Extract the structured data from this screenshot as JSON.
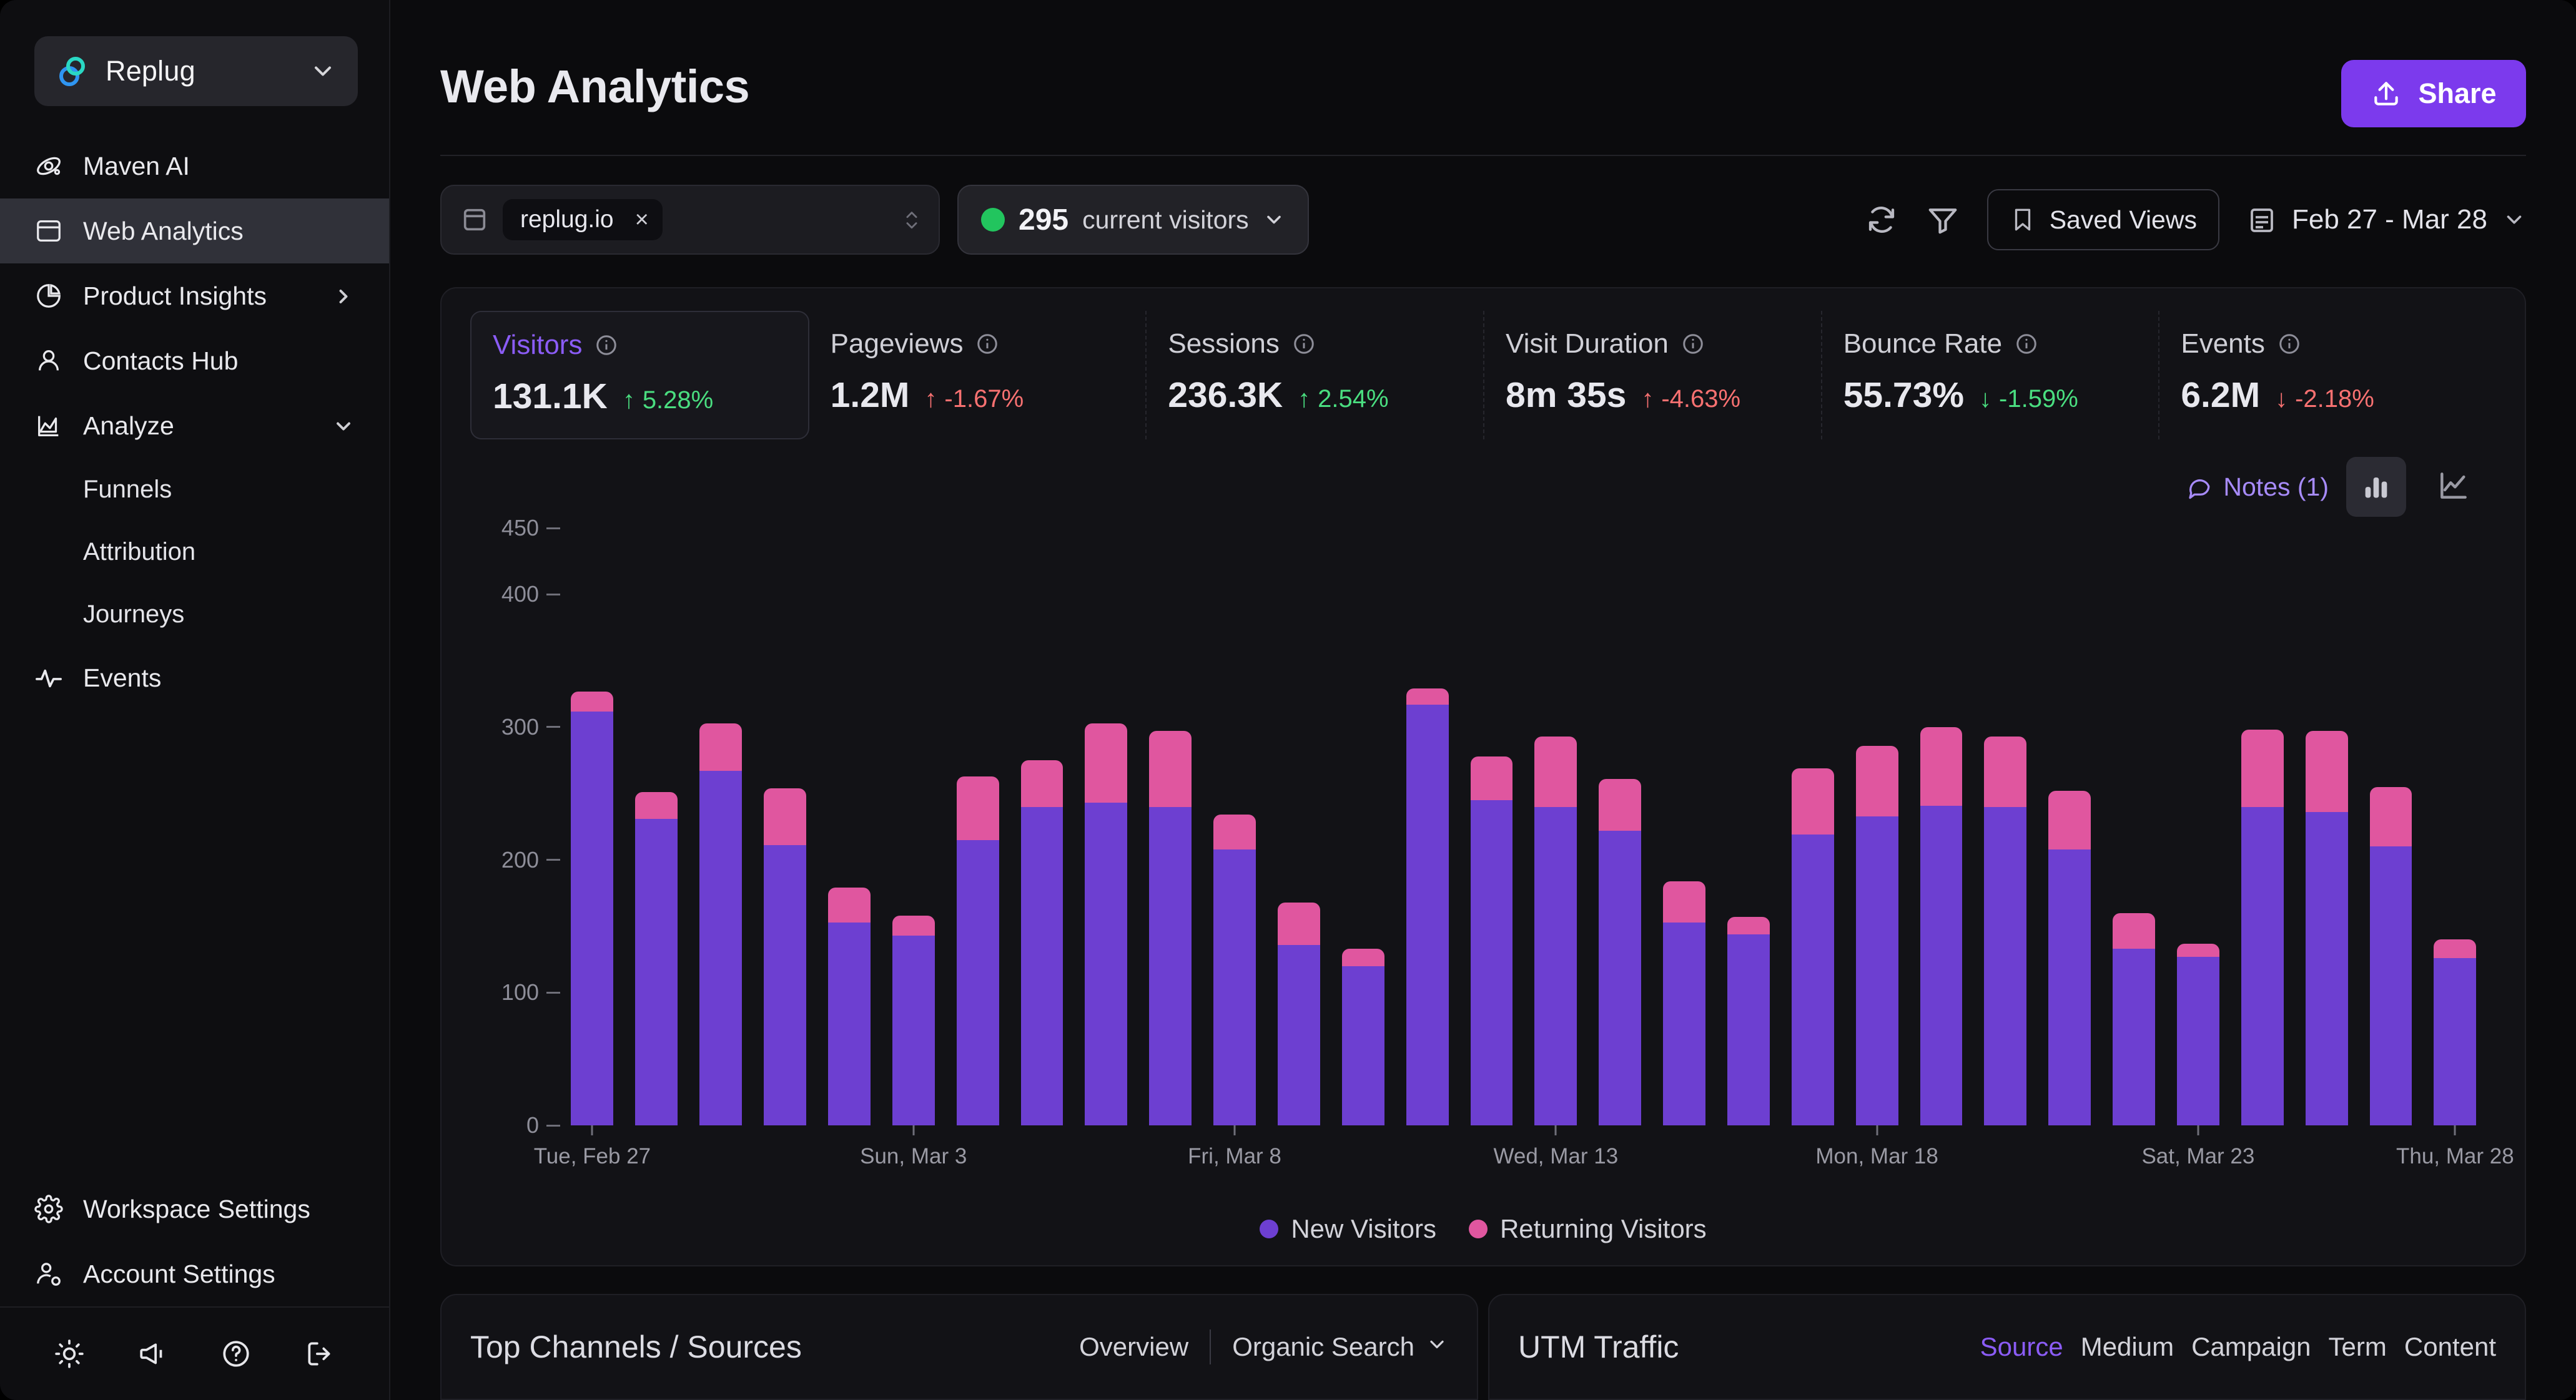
{
  "sidebar": {
    "workspace": {
      "name": "Replug",
      "icon": "replug-logo-icon",
      "chevron": "chevron-down-icon"
    },
    "items": [
      {
        "label": "Maven AI",
        "icon": "maven-ai-icon",
        "active": false,
        "caret": ""
      },
      {
        "label": "Web Analytics",
        "icon": "window-icon",
        "active": true,
        "caret": ""
      },
      {
        "label": "Product Insights",
        "icon": "pie-chart-icon",
        "active": false,
        "caret": "chevron-right-icon"
      },
      {
        "label": "Contacts Hub",
        "icon": "user-icon",
        "active": false,
        "caret": ""
      },
      {
        "label": "Analyze",
        "icon": "area-chart-icon",
        "active": false,
        "caret": "chevron-down-icon"
      }
    ],
    "sub_items": [
      "Funnels",
      "Attribution",
      "Journeys"
    ],
    "events_item": {
      "label": "Events",
      "icon": "pulse-icon"
    },
    "bottom_items": [
      {
        "label": "Workspace Settings",
        "icon": "gear-icon"
      },
      {
        "label": "Account Settings",
        "icon": "user-gear-icon"
      }
    ],
    "footer_icons": [
      "brightness-icon",
      "megaphone-icon",
      "help-circle-icon",
      "logout-icon"
    ]
  },
  "header": {
    "title": "Web Analytics",
    "share_label": "Share",
    "share_icon": "upload-icon",
    "share_color": "#7c3aed"
  },
  "toolbar": {
    "site_icon": "browser-icon",
    "site_value": "replug.io",
    "site_clear": "×",
    "site_stepper": "stepper-icon",
    "live_dot_color": "#22c55e",
    "live_count": "295",
    "live_label": "current visitors",
    "live_chevron": "chevron-down-icon",
    "refresh_icon": "refresh-icon",
    "filter_icon": "funnel-icon",
    "saved_views_label": "Saved Views",
    "saved_views_icon": "bookmark-icon",
    "date_icon": "calendar-icon",
    "date_range": "Feb 27 - Mar 28",
    "date_chevron": "chevron-down-icon"
  },
  "metrics": [
    {
      "name": "Visitors",
      "value": "131.1K",
      "delta": "5.28%",
      "dir": "up",
      "arrow": "↑",
      "active": true,
      "info": "info-icon"
    },
    {
      "name": "Pageviews",
      "value": "1.2M",
      "delta": "-1.67%",
      "dir": "down",
      "arrow": "↑",
      "active": false,
      "info": "info-icon"
    },
    {
      "name": "Sessions",
      "value": "236.3K",
      "delta": "2.54%",
      "dir": "up",
      "arrow": "↑",
      "active": false,
      "info": "info-icon"
    },
    {
      "name": "Visit Duration",
      "value": "8m 35s",
      "delta": "-4.63%",
      "dir": "down",
      "arrow": "↑",
      "active": false,
      "info": "info-icon"
    },
    {
      "name": "Bounce Rate",
      "value": "55.73%",
      "delta": "-1.59%",
      "dir": "up",
      "arrow": "↓",
      "active": false,
      "info": "info-icon"
    },
    {
      "name": "Events",
      "value": "6.2M",
      "delta": "-2.18%",
      "dir": "down",
      "arrow": "↓",
      "active": false,
      "info": "info-icon"
    }
  ],
  "chart_tools": {
    "notes_label": "Notes (1)",
    "notes_icon": "comment-icon",
    "bar_toggle_icon": "bar-chart-icon",
    "line_toggle_icon": "line-chart-icon",
    "selected_toggle": "bar"
  },
  "chart_data": {
    "type": "bar",
    "stacked": true,
    "title": "",
    "xlabel": "",
    "ylabel": "",
    "ylim": [
      0,
      450
    ],
    "yticks": [
      0,
      100,
      200,
      300,
      400,
      450
    ],
    "grid": false,
    "legend_position": "bottom",
    "series": [
      {
        "name": "New Visitors",
        "color": "#6d3fd1",
        "values": [
          312,
          231,
          267,
          211,
          153,
          143,
          215,
          240,
          243,
          240,
          208,
          136,
          120,
          317,
          245,
          240,
          222,
          153,
          144,
          219,
          233,
          241,
          240,
          208,
          133,
          127,
          240,
          236,
          210,
          126
        ]
      },
      {
        "name": "Returning Visitors",
        "color": "#e0569f",
        "values": [
          15,
          20,
          36,
          43,
          26,
          15,
          48,
          35,
          60,
          57,
          26,
          32,
          13,
          12,
          33,
          53,
          39,
          31,
          13,
          50,
          53,
          59,
          53,
          44,
          27,
          10,
          58,
          61,
          45,
          14
        ]
      }
    ],
    "categories": [
      "Tue, Feb 27",
      "Wed, Feb 28",
      "Thu, Feb 29",
      "Fri, Mar 1",
      "Sat, Mar 2",
      "Sun, Mar 3",
      "Mon, Mar 4",
      "Tue, Mar 5",
      "Wed, Mar 6",
      "Thu, Mar 7",
      "Fri, Mar 8",
      "Sat, Mar 9",
      "Sun, Mar 10",
      "Mon, Mar 11",
      "Tue, Mar 12",
      "Wed, Mar 13",
      "Thu, Mar 14",
      "Fri, Mar 15",
      "Sat, Mar 16",
      "Sun, Mar 17",
      "Mon, Mar 18",
      "Tue, Mar 19",
      "Wed, Mar 20",
      "Thu, Mar 21",
      "Fri, Mar 22",
      "Sat, Mar 23",
      "Sun, Mar 24",
      "Mon, Mar 25",
      "Tue, Mar 26",
      "Thu, Mar 28"
    ],
    "xtick_labels": [
      "Tue, Feb 27",
      "Sun, Mar 3",
      "Fri, Mar 8",
      "Wed, Mar 13",
      "Mon, Mar 18",
      "Sat, Mar 23",
      "Thu, Mar 28"
    ],
    "xtick_indices": [
      0,
      5,
      10,
      15,
      20,
      25,
      29
    ],
    "legend": [
      "New Visitors",
      "Returning Visitors"
    ]
  },
  "bottom": {
    "channels": {
      "title": "Top Channels / Sources",
      "tab_overview": "Overview",
      "dropdown_value": "Organic Search",
      "dropdown_chevron": "chevron-down-icon"
    },
    "utm": {
      "title": "UTM Traffic",
      "tabs": [
        "Source",
        "Medium",
        "Campaign",
        "Term",
        "Content"
      ],
      "selected_tab": "Source"
    }
  }
}
